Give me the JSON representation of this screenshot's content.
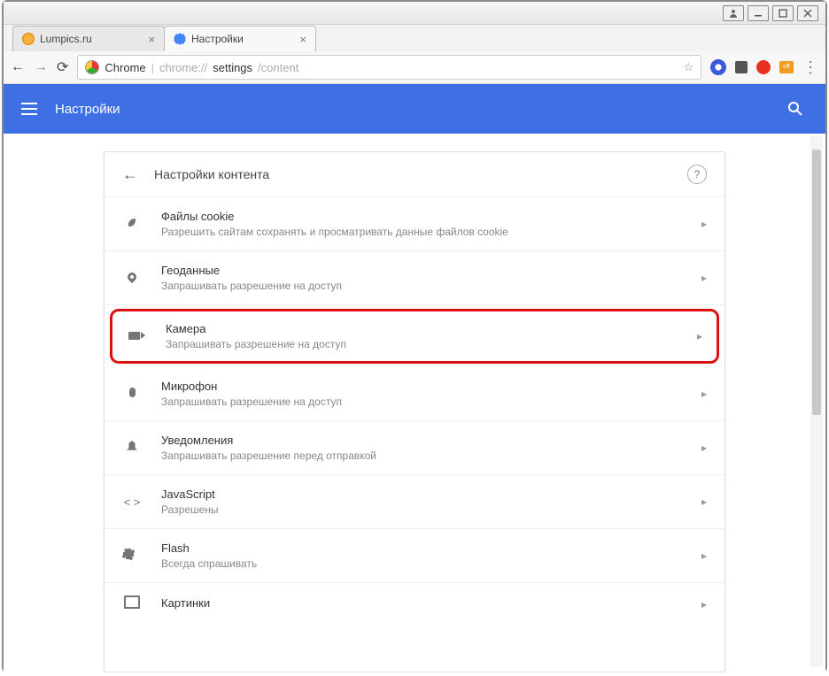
{
  "os": {
    "user_btn": "",
    "min_btn": "",
    "max_btn": "",
    "close_btn": ""
  },
  "tabs": [
    {
      "label": "Lumpics.ru",
      "icon_color": "#f5a623",
      "active": false
    },
    {
      "label": "Настройки",
      "icon_color": "#4285f4",
      "active": true
    }
  ],
  "nav": {
    "chrome_label": "Chrome",
    "url_prefix": "chrome://",
    "url_bold": "settings",
    "url_rest": "/content"
  },
  "header": {
    "title": "Настройки"
  },
  "panel": {
    "title": "Настройки контента"
  },
  "rows": [
    {
      "icon": "cookie",
      "title": "Файлы cookie",
      "sub": "Разрешить сайтам сохранять и просматривать данные файлов cookie"
    },
    {
      "icon": "location",
      "title": "Геоданные",
      "sub": "Запрашивать разрешение на доступ"
    },
    {
      "icon": "camera",
      "title": "Камера",
      "sub": "Запрашивать разрешение на доступ",
      "highlight": true
    },
    {
      "icon": "mic",
      "title": "Микрофон",
      "sub": "Запрашивать разрешение на доступ"
    },
    {
      "icon": "bell",
      "title": "Уведомления",
      "sub": "Запрашивать разрешение перед отправкой"
    },
    {
      "icon": "js",
      "title": "JavaScript",
      "sub": "Разрешены"
    },
    {
      "icon": "flash",
      "title": "Flash",
      "sub": "Всегда спрашивать"
    },
    {
      "icon": "images",
      "title": "Картинки",
      "sub": ""
    }
  ]
}
